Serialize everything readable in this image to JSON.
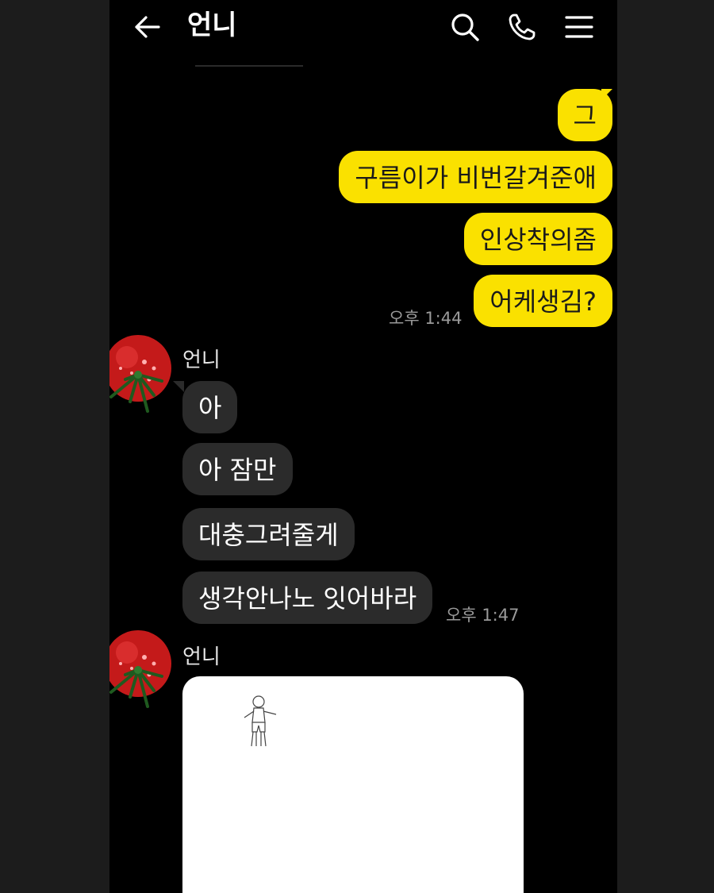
{
  "header": {
    "title": "언니",
    "back_icon": "arrow-left-icon",
    "search_icon": "search-icon",
    "call_icon": "phone-icon",
    "menu_icon": "menu-icon"
  },
  "colors": {
    "background": "#000000",
    "my_bubble": "#fae100",
    "their_bubble": "#2b2b2b",
    "timestamp": "#9a9a9a"
  },
  "messages": {
    "mine": [
      {
        "text": "그"
      },
      {
        "text": "구름이가 비번갈겨준애"
      },
      {
        "text": "인상착의좀"
      },
      {
        "text": "어케생김?"
      }
    ],
    "mine_time": "오후 1:44",
    "group1_sender": "언니",
    "theirs": [
      {
        "text": "아"
      },
      {
        "text": "아 잠만"
      },
      {
        "text": "대충그려줄게"
      },
      {
        "text": "생각안나노 잇어바라"
      }
    ],
    "theirs_time": "오후 1:47",
    "group2_sender": "언니"
  },
  "avatar_icon": "tomato-avatar-icon",
  "image_attachment": {
    "content_icon": "stick-figure-drawing-icon"
  }
}
